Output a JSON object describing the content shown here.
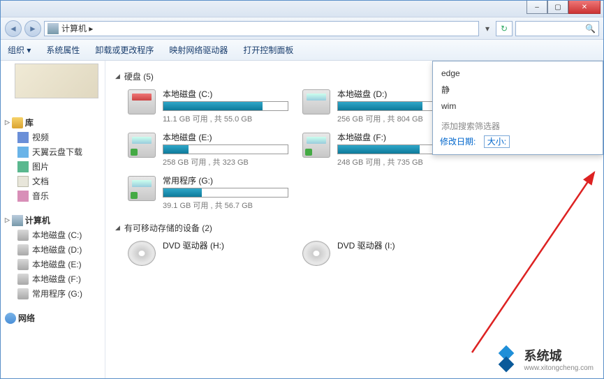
{
  "window": {
    "min_label": "–",
    "max_label": "▢",
    "close_label": "✕"
  },
  "address": {
    "text": "计算机  ▸",
    "drop": "▾",
    "refresh": "↻",
    "search_icon": "🔍"
  },
  "toolbar": {
    "organize": "组织 ▾",
    "sysprops": "系统属性",
    "uninstall": "卸载或更改程序",
    "mapdrive": "映射网络驱动器",
    "controlpanel": "打开控制面板"
  },
  "sidebar": {
    "library": {
      "label": "库",
      "items": [
        {
          "label": "视频"
        },
        {
          "label": "天翼云盘下载"
        },
        {
          "label": "图片"
        },
        {
          "label": "文档"
        },
        {
          "label": "音乐"
        }
      ]
    },
    "computer": {
      "label": "计算机",
      "items": [
        {
          "label": "本地磁盘 (C:)"
        },
        {
          "label": "本地磁盘 (D:)"
        },
        {
          "label": "本地磁盘 (E:)"
        },
        {
          "label": "本地磁盘 (F:)"
        },
        {
          "label": "常用程序 (G:)"
        }
      ]
    },
    "network": {
      "label": "网络"
    }
  },
  "content": {
    "hdd_header": "硬盘 (5)",
    "removable_header": "有可移动存储的设备 (2)",
    "drives": [
      {
        "name": "本地磁盘 (C:)",
        "stat": "11.1 GB 可用 , 共 55.0 GB",
        "fill": 80,
        "kind": "win"
      },
      {
        "name": "本地磁盘 (D:)",
        "stat": "256 GB 可用 , 共 804 GB",
        "fill": 68,
        "kind": "plain"
      },
      {
        "name": "本地磁盘 (E:)",
        "stat": "258 GB 可用 , 共 323 GB",
        "fill": 20,
        "kind": "data"
      },
      {
        "name": "本地磁盘 (F:)",
        "stat": "248 GB 可用 , 共 735 GB",
        "fill": 66,
        "kind": "data"
      },
      {
        "name": "常用程序 (G:)",
        "stat": "39.1 GB 可用 , 共 56.7 GB",
        "fill": 31,
        "kind": "data"
      }
    ],
    "dvds": [
      {
        "name": "DVD 驱动器 (H:)"
      },
      {
        "name": "DVD 驱动器 (I:)"
      }
    ]
  },
  "search_dropdown": {
    "opts": [
      "edge",
      "静",
      "wim"
    ],
    "hint": "添加搜索筛选器",
    "filter_date": "修改日期:",
    "filter_size": "大小:"
  },
  "watermark": {
    "title": "系统城",
    "sub": "www.xitongcheng.com"
  }
}
